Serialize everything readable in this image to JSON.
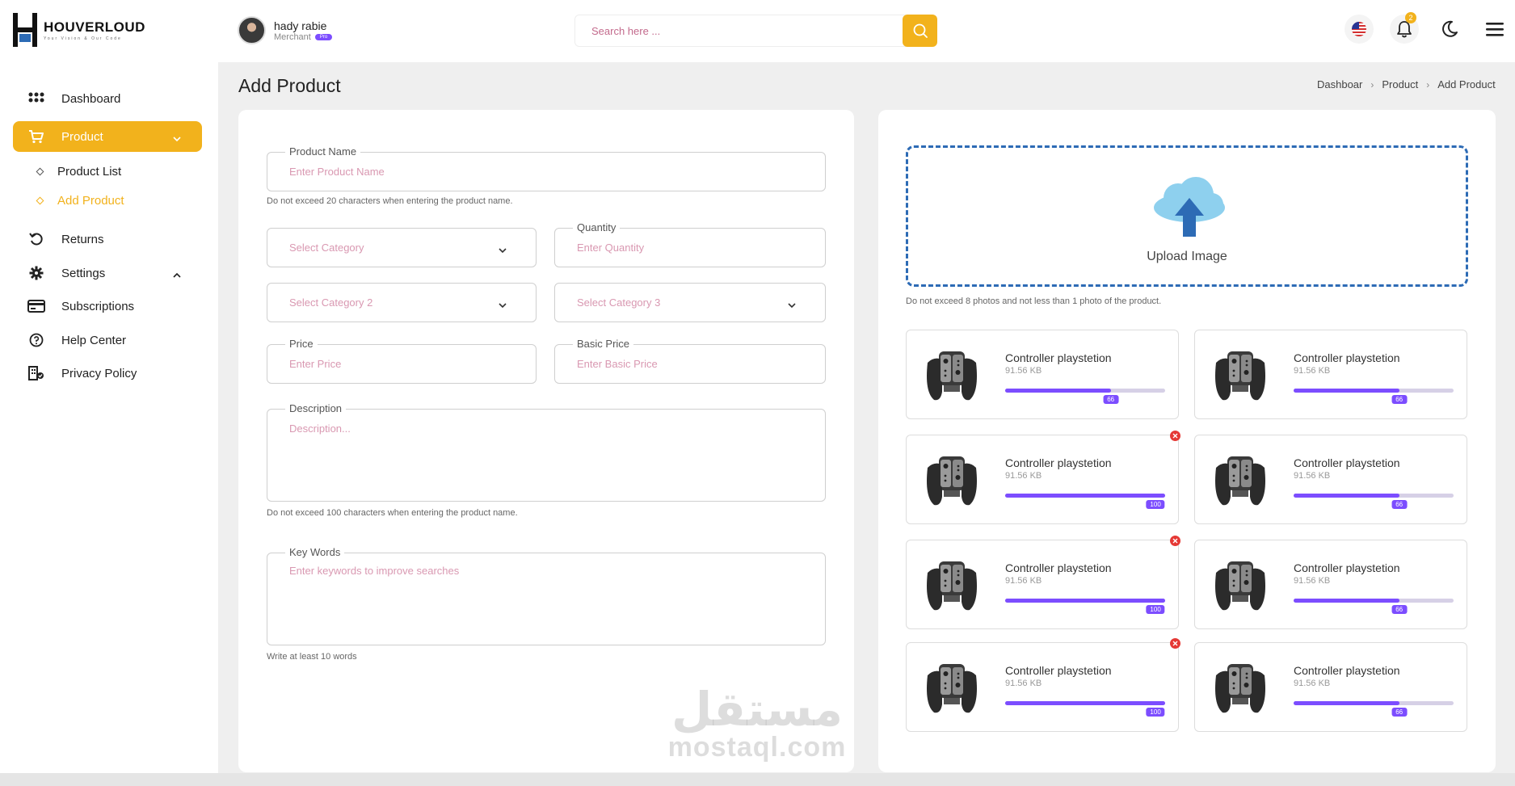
{
  "brand": {
    "name": "HOUVERLOUD",
    "tagline": "Your Vision & Our Code"
  },
  "user": {
    "name": "hady rabie",
    "role": "Merchant",
    "badge": "Pro"
  },
  "search": {
    "placeholder": "Search here ..."
  },
  "topbar": {
    "notification_count": "2",
    "icons": [
      "us-flag-icon",
      "bell-icon",
      "moon-icon",
      "menu-icon"
    ]
  },
  "sidebar": {
    "items": [
      {
        "label": "Dashboard",
        "icon": "grid-icon"
      },
      {
        "label": "Product",
        "icon": "cart-icon",
        "active": true
      },
      {
        "label": "Returns",
        "icon": "undo-icon"
      },
      {
        "label": "Settings",
        "icon": "gear-icon"
      },
      {
        "label": "Subscriptions",
        "icon": "credit-card-icon"
      },
      {
        "label": "Help Center",
        "icon": "help-icon"
      },
      {
        "label": "Privacy Policy",
        "icon": "building-icon"
      }
    ],
    "product_sub": [
      {
        "label": "Product List"
      },
      {
        "label": "Add Product",
        "active": true
      }
    ]
  },
  "page": {
    "title": "Add Product",
    "breadcrumb": [
      "Dashboar",
      "Product",
      "Add Product"
    ]
  },
  "form": {
    "product_name": {
      "label": "Product Name",
      "placeholder": "Enter Product Name",
      "hint": "Do not exceed 20 characters when entering the product name."
    },
    "category": {
      "placeholder": "Select Category"
    },
    "quantity": {
      "label": "Quantity",
      "placeholder": "Enter Quantity"
    },
    "category2": {
      "placeholder": "Select Category 2"
    },
    "category3": {
      "placeholder": "Select Category 3"
    },
    "price": {
      "label": "Price",
      "placeholder": "Enter Price"
    },
    "basic_price": {
      "label": "Basic Price",
      "placeholder": "Enter Basic Price"
    },
    "description": {
      "label": "Description",
      "placeholder": "Description...",
      "hint": "Do not exceed 100 characters when entering the product name."
    },
    "keywords": {
      "label": "Key Words",
      "placeholder": "Enter keywords to improve searches",
      "hint": "Write at least 10 words"
    }
  },
  "upload": {
    "label": "Upload Image",
    "hint": "Do not exceed 8 photos and not less than 1 photo of the product."
  },
  "images": [
    {
      "title": "Controller playstetion",
      "size": "91.56 KB",
      "progress": 66,
      "removable": false
    },
    {
      "title": "Controller playstetion",
      "size": "91.56 KB",
      "progress": 66,
      "removable": false
    },
    {
      "title": "Controller playstetion",
      "size": "91.56 KB",
      "progress": 100,
      "removable": true
    },
    {
      "title": "Controller playstetion",
      "size": "91.56 KB",
      "progress": 66,
      "removable": false
    },
    {
      "title": "Controller playstetion",
      "size": "91.56 KB",
      "progress": 100,
      "removable": true
    },
    {
      "title": "Controller playstetion",
      "size": "91.56 KB",
      "progress": 66,
      "removable": false
    },
    {
      "title": "Controller playstetion",
      "size": "91.56 KB",
      "progress": 100,
      "removable": true
    },
    {
      "title": "Controller playstetion",
      "size": "91.56 KB",
      "progress": 66,
      "removable": false
    }
  ],
  "watermark": {
    "arabic": "مستقل",
    "latin": "mostaql.com"
  },
  "colors": {
    "accent": "#f2b21c",
    "progress": "#7c4dff",
    "upload_border": "#2d6bb5",
    "remove": "#e53935"
  }
}
